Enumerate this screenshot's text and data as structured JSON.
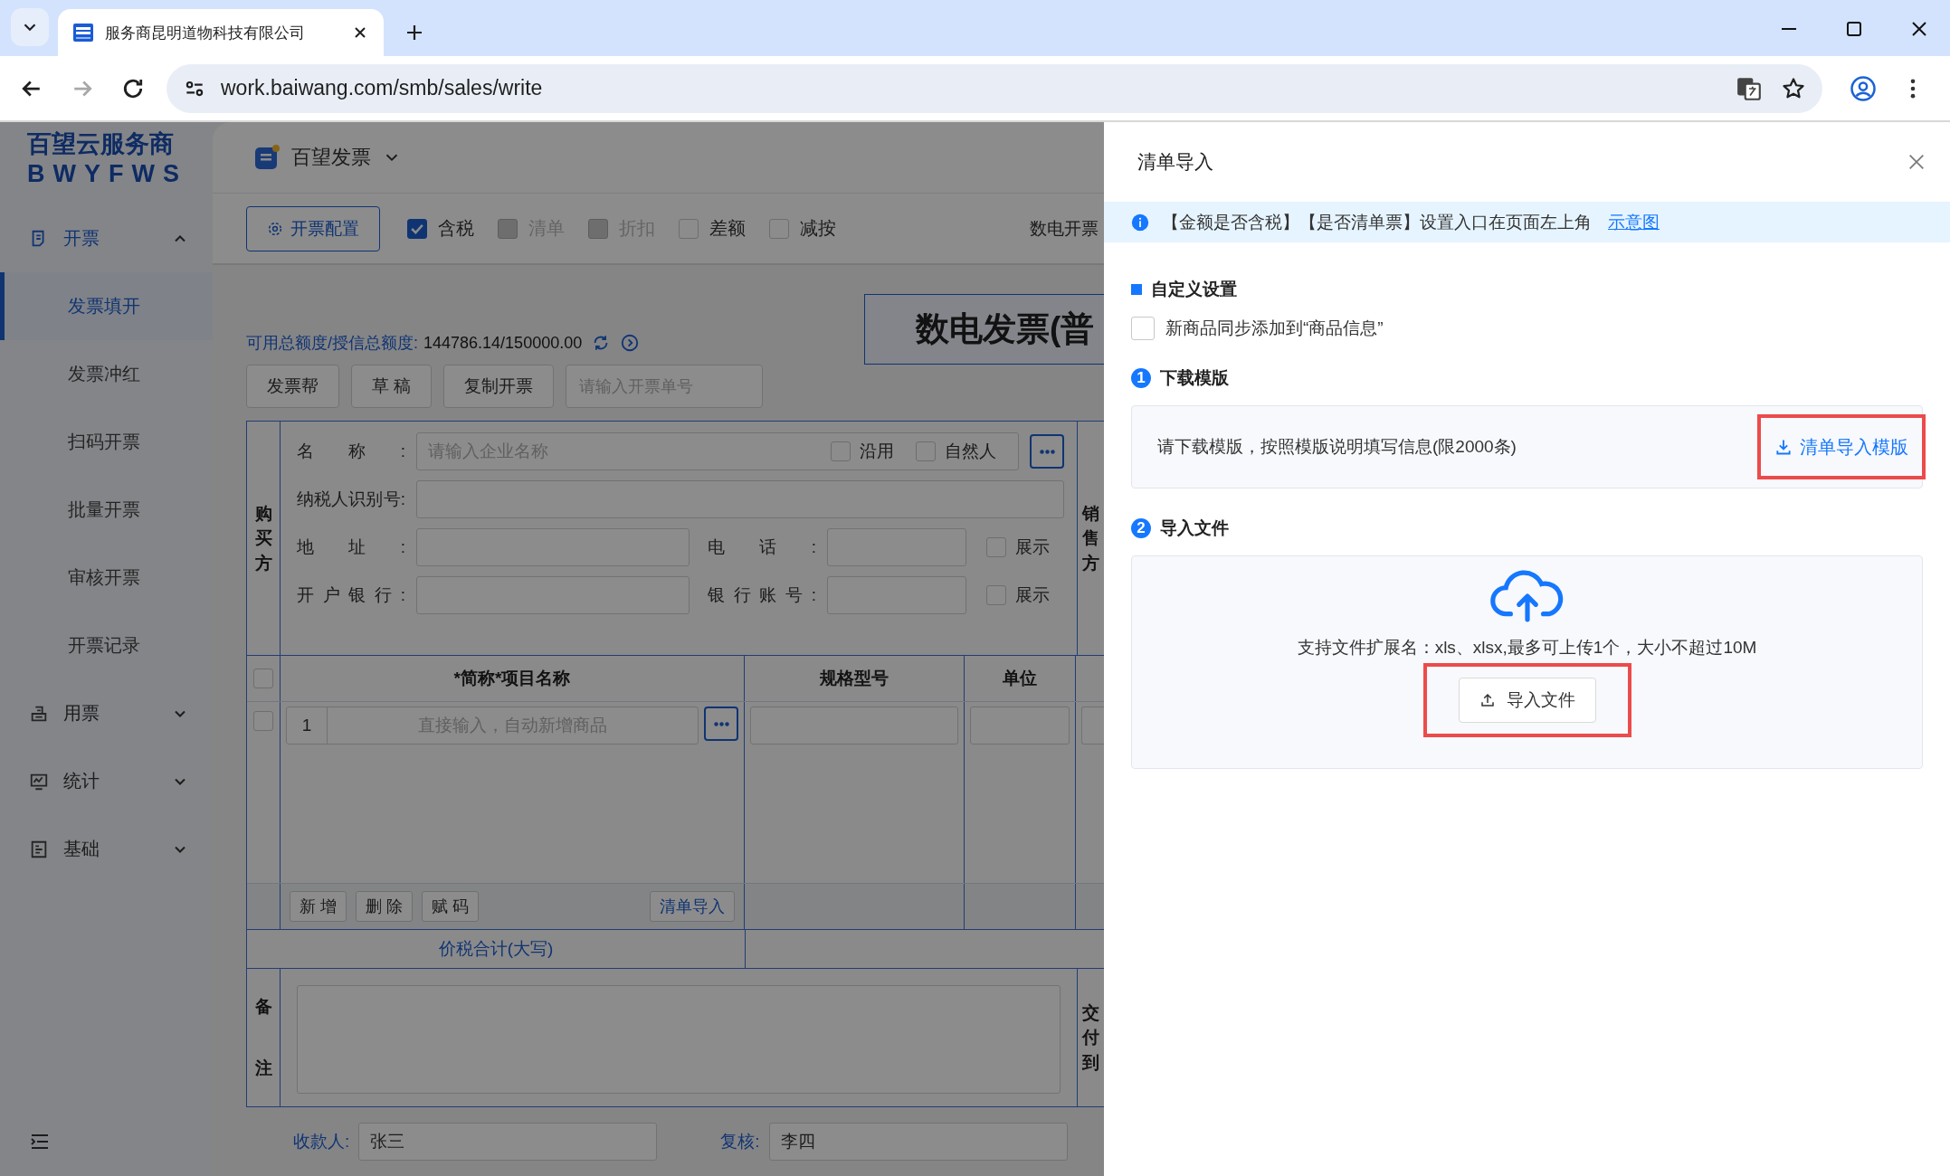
{
  "browser": {
    "tab_title": "服务商昆明道物科技有限公司",
    "url": "work.baiwang.com/smb/sales/write",
    "nav": [
      {
        "kind": "back",
        "disabled": false
      },
      {
        "kind": "forward",
        "disabled": true
      },
      {
        "kind": "reload",
        "disabled": false
      }
    ]
  },
  "sidebar": {
    "logo_title": "百望云服务商",
    "logo_subtitle": "BWYFWS",
    "items": [
      {
        "label": "开票",
        "expanded": true,
        "children": [
          {
            "label": "发票填开",
            "selected": true
          },
          {
            "label": "发票冲红",
            "selected": false
          },
          {
            "label": "扫码开票",
            "selected": false
          },
          {
            "label": "批量开票",
            "selected": false
          },
          {
            "label": "审核开票",
            "selected": false
          },
          {
            "label": "开票记录",
            "selected": false
          }
        ]
      },
      {
        "label": "用票",
        "expanded": false
      },
      {
        "label": "统计",
        "expanded": false
      },
      {
        "label": "基础",
        "expanded": false
      }
    ]
  },
  "app": {
    "name": "百望发票"
  },
  "toolbar": {
    "config_button": "开票配置",
    "options": [
      {
        "label": "含税",
        "checked": true,
        "disabled": false
      },
      {
        "label": "清单",
        "checked": false,
        "disabled": true
      },
      {
        "label": "折扣",
        "checked": false,
        "disabled": true
      },
      {
        "label": "差额",
        "checked": false,
        "disabled": false
      },
      {
        "label": "减按",
        "checked": false,
        "disabled": false
      }
    ],
    "right_label": "数电开票"
  },
  "quota": {
    "label": "可用总额度/授信总额度:",
    "value": "144786.14/150000.00"
  },
  "invoice_title": "数电发票(普",
  "actions": [
    "发票帮",
    "草 稿",
    "复制开票"
  ],
  "order_search": {
    "placeholder": "请输入开票单号"
  },
  "buyer": {
    "label": "购买方",
    "name": {
      "label": "名称:",
      "placeholder": "请输入企业名称"
    },
    "name_options": [
      {
        "label": "沿用",
        "checked": false
      },
      {
        "label": "自然人",
        "checked": false
      }
    ],
    "tax_id": {
      "label": "纳税人识别号:"
    },
    "address": {
      "label": "地址:"
    },
    "phone": {
      "label": "电话:"
    },
    "bank": {
      "label": "开户银行:"
    },
    "account": {
      "label": "银行账号:"
    },
    "show_options": [
      {
        "label": "展示",
        "checked": false
      },
      {
        "label": "展示",
        "checked": false
      }
    ]
  },
  "seller": {
    "label": "销售方"
  },
  "items": {
    "header_checked": false,
    "columns": [
      "*简称*项目名称",
      "规格型号",
      "单位"
    ],
    "rows": [
      {
        "index": "1",
        "placeholder": "直接输入，自动新增商品",
        "checked": false
      }
    ],
    "buttons": [
      "新 增",
      "删 除",
      "赋 码"
    ],
    "import_link": "清单导入"
  },
  "total_label": "价税合计(大写)",
  "remarks": {
    "label": "备注"
  },
  "delivery": {
    "label": "交付到"
  },
  "signers": [
    {
      "label": "收款人:",
      "value": "张三"
    },
    {
      "label": "复核:",
      "value": "李四"
    }
  ],
  "drawer": {
    "title": "清单导入",
    "notice": {
      "text": "【金额是否含税】【是否清单票】设置入口在页面左上角",
      "link": "示意图"
    },
    "custom_settings": {
      "title": "自定义设置",
      "option": {
        "label": "新商品同步添加到“商品信息”",
        "checked": false
      }
    },
    "steps": [
      {
        "number": "1",
        "title": "下载模版"
      },
      {
        "number": "2",
        "title": "导入文件"
      }
    ],
    "download": {
      "text": "请下载模版，按照模版说明填写信息(限2000条)",
      "button": "清单导入模版",
      "highlighted": true
    },
    "upload": {
      "hint": "支持文件扩展名：xls、xlsx,最多可上传1个，大小不超过10M",
      "button": "导入文件",
      "highlighted": true
    }
  }
}
